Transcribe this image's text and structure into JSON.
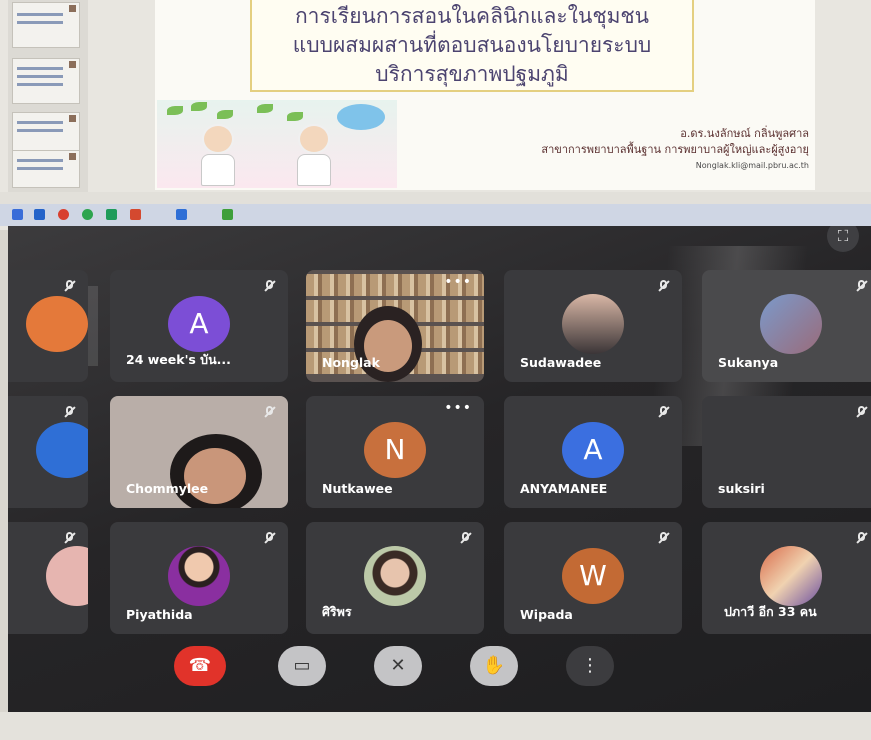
{
  "slide": {
    "title_lines": [
      "การเรียนการสอนในคลินิกและในชุมชน",
      "แบบผสมผสานที่ตอบสนองนโยบายระบบ",
      "บริการสุขภาพปฐมภูมิ"
    ],
    "author": "อ.ดร.นงลักษณ์ กลิ่นพูลศาล",
    "department": "สาขาการพยาบาลพื้นฐาน การพยาบาลผู้ใหญ่และผู้สูงอายุ",
    "email": "Nonglak.kli@mail.pbru.ac.th"
  },
  "participants": [
    {
      "name": "",
      "avatar_letter": "",
      "avatar_color": "#e4793a",
      "kind": "partial"
    },
    {
      "name": "24 week's บัน...",
      "avatar_letter": "A",
      "avatar_color": "#7c4ed6",
      "kind": "letter"
    },
    {
      "name": "Nonglak",
      "kind": "video"
    },
    {
      "name": "Sudawadee",
      "kind": "photo"
    },
    {
      "name": "Sukanya",
      "kind": "photo"
    },
    {
      "name": "",
      "avatar_color": "#2f6fd6",
      "kind": "partial"
    },
    {
      "name": "Chommylee",
      "kind": "video"
    },
    {
      "name": "Nutkawee",
      "avatar_letter": "N",
      "avatar_color": "#c8703d",
      "kind": "letter"
    },
    {
      "name": "ANYAMANEE",
      "avatar_letter": "A",
      "avatar_color": "#3b6fe0",
      "kind": "letter"
    },
    {
      "name": "suksiri",
      "kind": "blank"
    },
    {
      "name": "",
      "kind": "partial"
    },
    {
      "name": "Piyathida",
      "kind": "photo"
    },
    {
      "name": "ศิริพร",
      "kind": "photo"
    },
    {
      "name": "Wipada",
      "avatar_letter": "W",
      "avatar_color": "#c36a34",
      "kind": "letter"
    },
    {
      "name": "ปภาวี  อีก 33 คน",
      "kind": "photo"
    }
  ],
  "controls": {
    "end_call": "end-call",
    "camera": "camera-off",
    "mic": "mic-off",
    "raise_hand": "raise-hand",
    "more": "⋮"
  },
  "colors": {
    "end_call": "#e1332a",
    "stage": "#262527"
  }
}
